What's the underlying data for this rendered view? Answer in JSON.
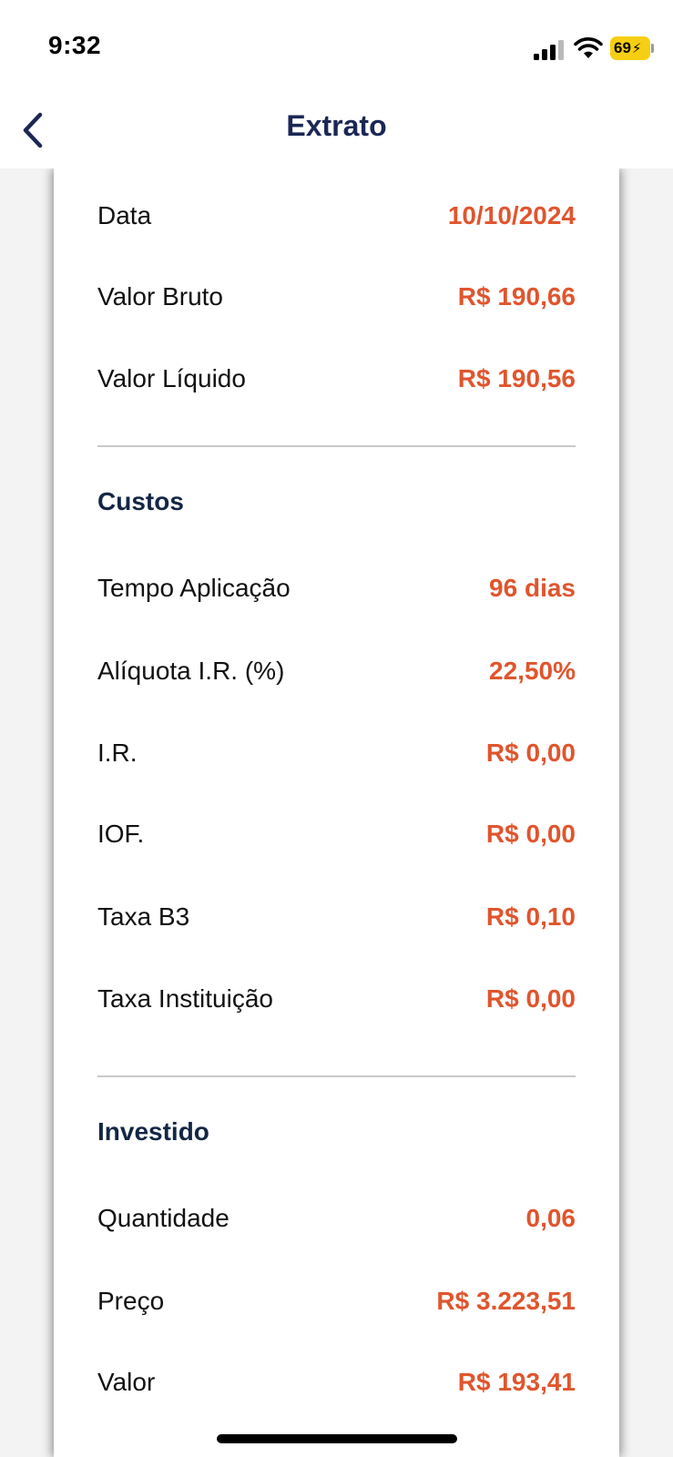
{
  "status_bar": {
    "time": "9:32",
    "battery_level": "69",
    "icons": [
      "signal-icon",
      "wifi-icon",
      "battery-icon",
      "charging-bolt-icon"
    ]
  },
  "nav": {
    "title": "Extrato",
    "back_icon": "chevron-left-icon"
  },
  "summary": [
    {
      "label": "Data",
      "value": "10/10/2024"
    },
    {
      "label": "Valor Bruto",
      "value": "R$ 190,66"
    },
    {
      "label": "Valor Líquido",
      "value": "R$ 190,56"
    }
  ],
  "custos": {
    "title": "Custos",
    "rows": [
      {
        "label": "Tempo Aplicação",
        "value": "96 dias"
      },
      {
        "label": "Alíquota I.R. (%)",
        "value": "22,50%"
      },
      {
        "label": "I.R.",
        "value": "R$ 0,00"
      },
      {
        "label": "IOF.",
        "value": "R$ 0,00"
      },
      {
        "label": "Taxa B3",
        "value": "R$ 0,10"
      },
      {
        "label": "Taxa Instituição",
        "value": "R$ 0,00"
      }
    ]
  },
  "investido": {
    "title": "Investido",
    "rows": [
      {
        "label": "Quantidade",
        "value": "0,06"
      },
      {
        "label": "Preço",
        "value": "R$ 3.223,51"
      },
      {
        "label": "Valor",
        "value": "R$ 193,41"
      }
    ]
  },
  "colors": {
    "accent_value": "#e0552d",
    "title_navy": "#1c2755",
    "section_navy": "#142645",
    "battery_yellow": "#f6cf13"
  }
}
